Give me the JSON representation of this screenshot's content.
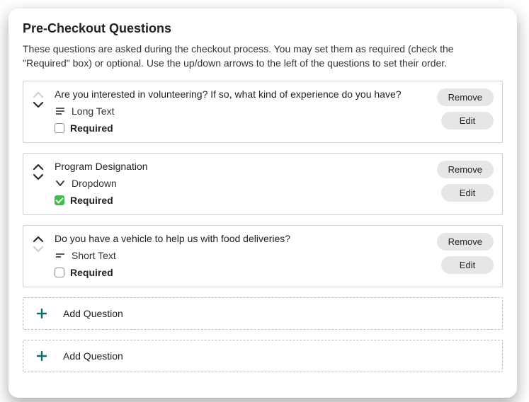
{
  "header": {
    "title": "Pre-Checkout Questions",
    "subtitle": "These questions are asked during the checkout process. You may set them as required (check the \"Required\" box) or optional. Use the up/down arrows to the left of the questions to set their order."
  },
  "buttons": {
    "remove": "Remove",
    "edit": "Edit",
    "add": "Add Question"
  },
  "labels": {
    "required": "Required"
  },
  "questions": [
    {
      "text": "Are you interested in volunteering? If so, what kind of experience do you have?",
      "type_label": "Long Text",
      "type_icon": "long-text",
      "required": false,
      "up_enabled": false,
      "down_enabled": true
    },
    {
      "text": "Program Designation",
      "type_label": "Dropdown",
      "type_icon": "dropdown",
      "required": true,
      "up_enabled": true,
      "down_enabled": true
    },
    {
      "text": "Do you have a vehicle to help us with food deliveries?",
      "type_label": "Short Text",
      "type_icon": "short-text",
      "required": false,
      "up_enabled": true,
      "down_enabled": false
    }
  ],
  "add_rows": 2,
  "colors": {
    "accent_green": "#3fbf4a",
    "teal": "#0f6e6e"
  }
}
